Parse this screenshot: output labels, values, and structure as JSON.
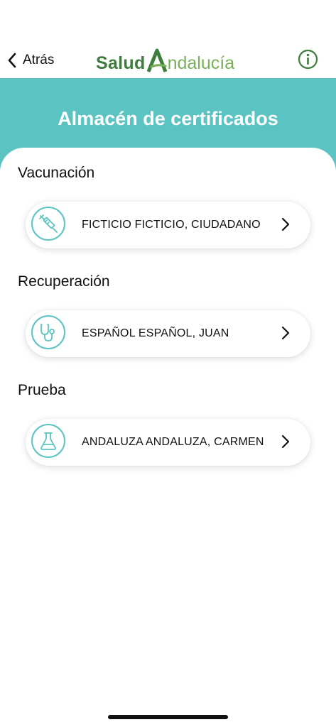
{
  "nav": {
    "back_label": "Atrás",
    "logo_part1": "Salud",
    "logo_part2": "ndalucía"
  },
  "header": {
    "title": "Almacén de certificados"
  },
  "sections": [
    {
      "title": "Vacunación",
      "name": "FICTICIO FICTICIO, CIUDADANO",
      "icon": "syringe-icon"
    },
    {
      "title": "Recuperación",
      "name": "ESPAÑOL ESPAÑOL, JUAN",
      "icon": "stethoscope-icon"
    },
    {
      "title": "Prueba",
      "name": "ANDALUZA ANDALUZA, CARMEN",
      "icon": "flask-icon"
    }
  ],
  "colors": {
    "accent": "#5bc4c3",
    "logo_dark_green": "#3f7d3c",
    "logo_light_green": "#7ab05a"
  }
}
